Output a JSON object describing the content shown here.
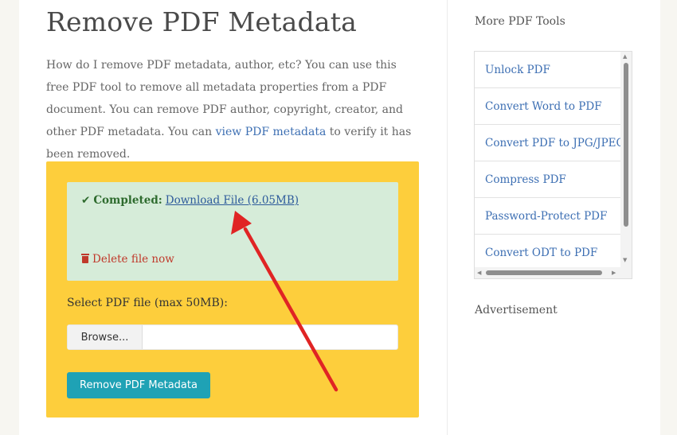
{
  "main": {
    "title": "Remove PDF Metadata",
    "intro_1": "How do I remove PDF metadata, author, etc? You can use this free PDF tool to remove all metadata properties from a PDF document. You can remove PDF author, copyright, creator, and other PDF metadata. You can ",
    "intro_link": "view PDF metadata",
    "intro_2": " to verify it has been removed."
  },
  "result": {
    "check_icon": "✔",
    "completed_label": "Completed:",
    "download_link": "Download File (6.05MB)",
    "delete_label": "Delete file now"
  },
  "form": {
    "select_label": "Select PDF file (max 50MB):",
    "browse_label": "Browse...",
    "submit_label": "Remove PDF Metadata"
  },
  "sidebar": {
    "title": "More PDF Tools",
    "tools": [
      {
        "label": "Unlock PDF"
      },
      {
        "label": "Convert Word to PDF"
      },
      {
        "label": "Convert PDF to JPG/JPEG"
      },
      {
        "label": "Compress PDF"
      },
      {
        "label": "Password-Protect PDF"
      },
      {
        "label": "Convert ODT to PDF"
      }
    ],
    "ad_title": "Advertisement"
  },
  "colors": {
    "panel": "#fdce3c",
    "success_bg": "#d6ecd9",
    "button": "#1fa2b5",
    "link": "#3d6fb3",
    "annotation_arrow": "#e02424"
  }
}
